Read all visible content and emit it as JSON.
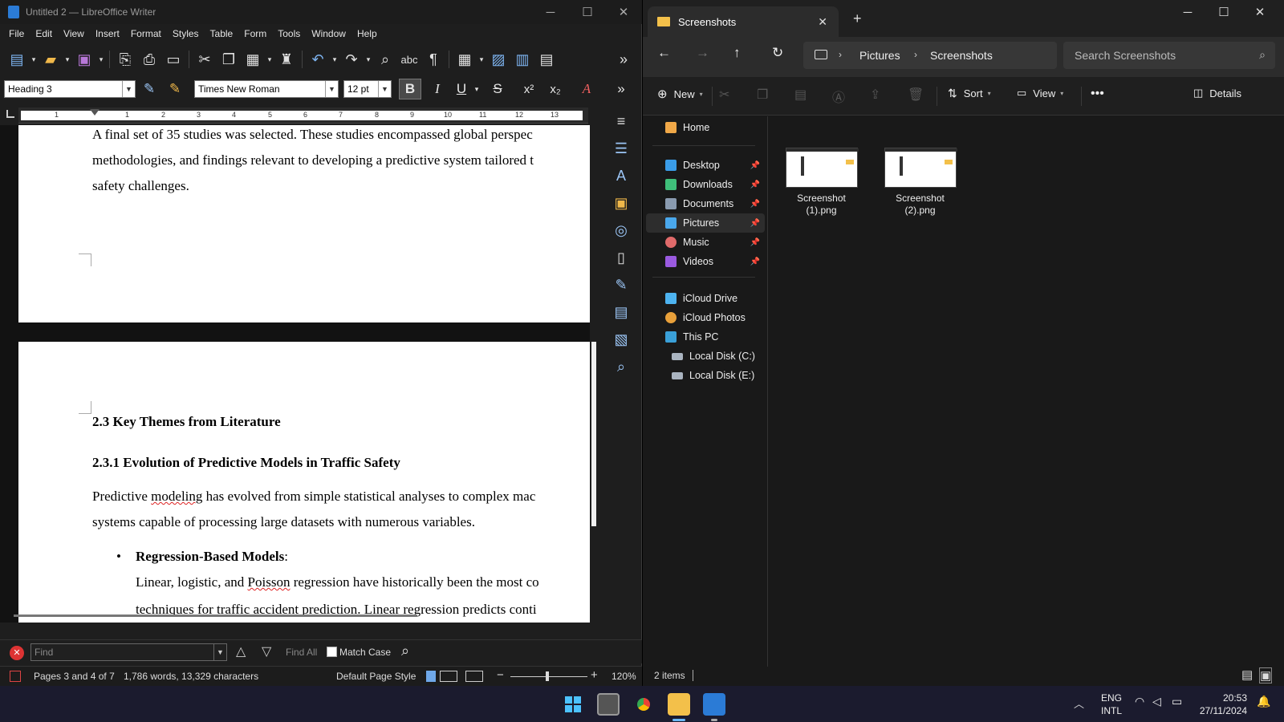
{
  "writer": {
    "title": "Untitled 2 — LibreOffice Writer",
    "menu": [
      "File",
      "Edit",
      "View",
      "Insert",
      "Format",
      "Styles",
      "Table",
      "Form",
      "Tools",
      "Window",
      "Help"
    ],
    "paragraph_style": "Heading 3",
    "font_name": "Times New Roman",
    "font_size": "12 pt",
    "ruler_numbers": [
      "1",
      "1",
      "2",
      "3",
      "4",
      "5",
      "6",
      "7",
      "8",
      "9",
      "10",
      "11",
      "12",
      "13"
    ],
    "page1": {
      "line1": "A final set of 35 studies was selected. These studies encompassed global perspec",
      "line2": "methodologies, and findings relevant to developing a predictive system tailored t",
      "line3": "safety challenges."
    },
    "page2": {
      "heading1": "2.3 Key Themes from Literature",
      "heading2": "2.3.1 Evolution of Predictive Models in Traffic Safety",
      "para1_a": "Predictive ",
      "para1_b": "modeling",
      "para1_c": " has evolved from simple statistical analyses to complex mac",
      "para2": "systems capable of processing large datasets with numerous variables.",
      "bullet_title": "Regression-Based Models",
      "bullet_colon": ":",
      "bullet_a": "Linear, logistic, and ",
      "bullet_b": "Poisson",
      "bullet_c": " regression have historically been the most co",
      "bullet_cut": "techniques for traffic accident prediction. Linear regression predicts conti"
    },
    "find": {
      "placeholder": "Find",
      "find_all": "Find All",
      "match_case": "Match Case"
    },
    "status": {
      "pages": "Pages 3 and 4 of 7",
      "words": "1,786 words, 13,329 characters",
      "page_style": "Default Page Style",
      "zoom": "120%"
    }
  },
  "explorer": {
    "tab_title": "Screenshots",
    "breadcrumb": [
      "Pictures",
      "Screenshots"
    ],
    "search_placeholder": "Search Screenshots",
    "commands": {
      "new": "New",
      "sort": "Sort",
      "view": "View",
      "details": "Details"
    },
    "nav": {
      "home": "Home",
      "pinned": [
        "Desktop",
        "Downloads",
        "Documents",
        "Pictures",
        "Music",
        "Videos"
      ],
      "cloud": [
        "iCloud Drive",
        "iCloud Photos"
      ],
      "this_pc": "This PC",
      "drives": [
        "Local Disk (C:)",
        "Local Disk (E:)"
      ]
    },
    "files": [
      {
        "line1": "Screenshot",
        "line2": "(1).png"
      },
      {
        "line1": "Screenshot",
        "line2": "(2).png"
      }
    ],
    "status": "2 items"
  },
  "taskbar": {
    "lang1": "ENG",
    "lang2": "INTL",
    "time": "20:53",
    "date": "27/11/2024"
  },
  "colors": {
    "accent_blue": "#2b7bd6",
    "folder_yellow": "#f3c04a",
    "spell_red": "#dd2222"
  }
}
